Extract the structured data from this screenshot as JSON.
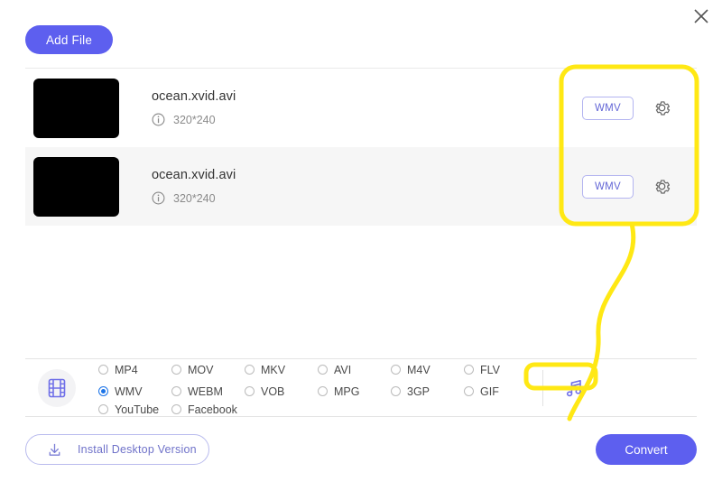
{
  "window": {
    "close_label": "×",
    "close_icon": "close-icon"
  },
  "toolbar": {
    "add_file_label": "Add File"
  },
  "file_list": {
    "rows": [
      {
        "name": "ocean.xvid.avi",
        "resolution": "320*240",
        "output_format": "WMV",
        "info_icon": "info-icon",
        "settings_icon": "gear-icon"
      },
      {
        "name": "ocean.xvid.avi",
        "resolution": "320*240",
        "output_format": "WMV",
        "info_icon": "info-icon",
        "settings_icon": "gear-icon"
      }
    ]
  },
  "format_bar": {
    "video_icon": "film-strip-icon",
    "audio_icon": "music-note-icon",
    "options": [
      {
        "label": "MP4",
        "selected": false
      },
      {
        "label": "MOV",
        "selected": false
      },
      {
        "label": "MKV",
        "selected": false
      },
      {
        "label": "AVI",
        "selected": false
      },
      {
        "label": "M4V",
        "selected": false
      },
      {
        "label": "FLV",
        "selected": false
      },
      {
        "label": "WMV",
        "selected": true
      },
      {
        "label": "WEBM",
        "selected": false
      },
      {
        "label": "VOB",
        "selected": false
      },
      {
        "label": "MPG",
        "selected": false
      },
      {
        "label": "3GP",
        "selected": false
      },
      {
        "label": "GIF",
        "selected": false
      },
      {
        "label": "YouTube",
        "selected": false
      },
      {
        "label": "Facebook",
        "selected": false
      }
    ],
    "selected_format": "WMV"
  },
  "footer": {
    "install_label": "Install Desktop Version",
    "install_icon": "download-icon",
    "convert_label": "Convert"
  },
  "annotation": {
    "highlight_color": "#FFE814",
    "description": "yellow callout linking row format buttons to WMV radio option"
  },
  "colors": {
    "accent_purple": "#5d5fef",
    "chip_purple": "#6366d6",
    "radio_blue": "#1a73e8",
    "annotation_yellow": "#FFE814",
    "row_alt_bg": "#f6f6f6"
  }
}
